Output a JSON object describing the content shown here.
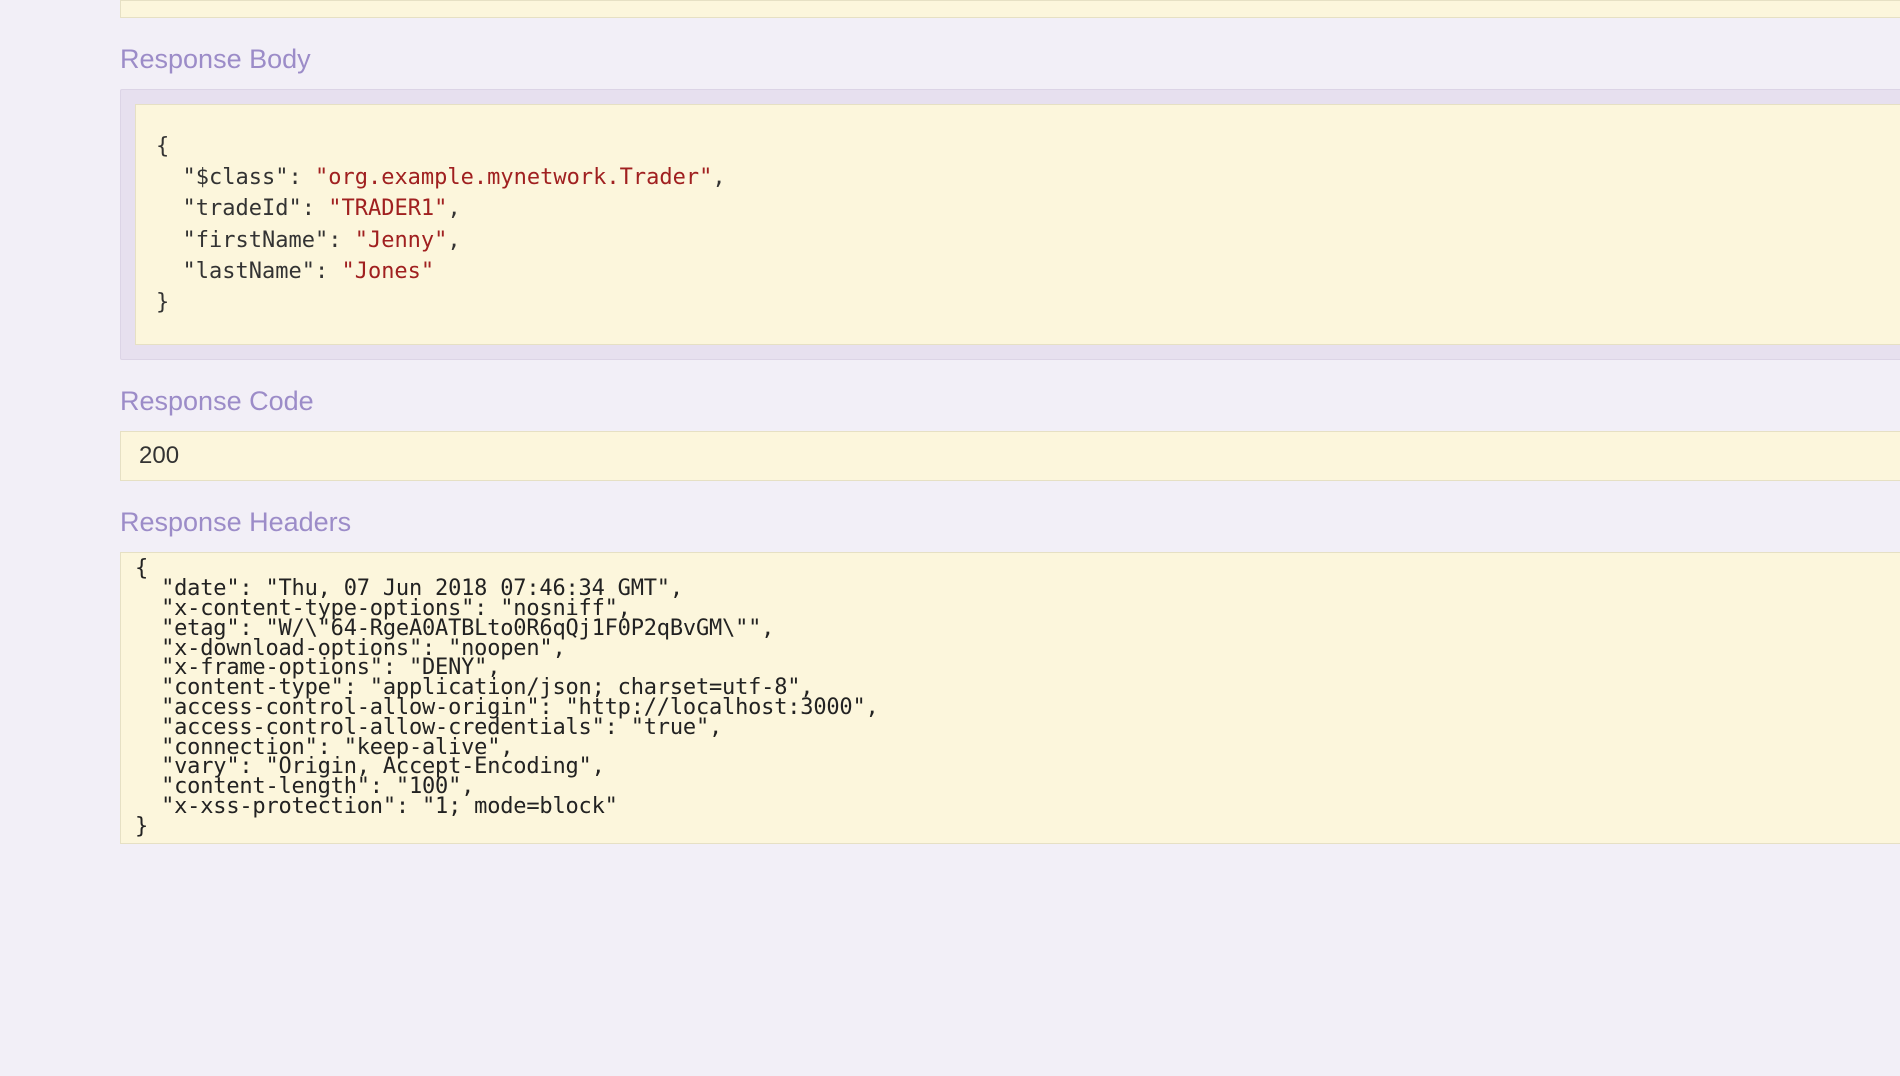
{
  "headings": {
    "body": "Response Body",
    "code": "Response Code",
    "headers": "Response Headers"
  },
  "responseCode": "200",
  "responseBody": {
    "open": "{",
    "close": "}",
    "lines": [
      {
        "key": "\"$class\"",
        "value": "\"org.example.mynetwork.Trader\"",
        "comma": ","
      },
      {
        "key": "\"tradeId\"",
        "value": "\"TRADER1\"",
        "comma": ","
      },
      {
        "key": "\"firstName\"",
        "value": "\"Jenny\"",
        "comma": ","
      },
      {
        "key": "\"lastName\"",
        "value": "\"Jones\"",
        "comma": ""
      }
    ]
  },
  "responseHeaders": {
    "open": "{",
    "close": "}",
    "lines": [
      "  \"date\": \"Thu, 07 Jun 2018 07:46:34 GMT\",",
      "  \"x-content-type-options\": \"nosniff\",",
      "  \"etag\": \"W/\\\"64-RgeA0ATBLto0R6qQj1F0P2qBvGM\\\"\",",
      "  \"x-download-options\": \"noopen\",",
      "  \"x-frame-options\": \"DENY\",",
      "  \"content-type\": \"application/json; charset=utf-8\",",
      "  \"access-control-allow-origin\": \"http://localhost:3000\",",
      "  \"access-control-allow-credentials\": \"true\",",
      "  \"connection\": \"keep-alive\",",
      "  \"vary\": \"Origin, Accept-Encoding\",",
      "  \"content-length\": \"100\",",
      "  \"x-xss-protection\": \"1; mode=block\""
    ]
  }
}
